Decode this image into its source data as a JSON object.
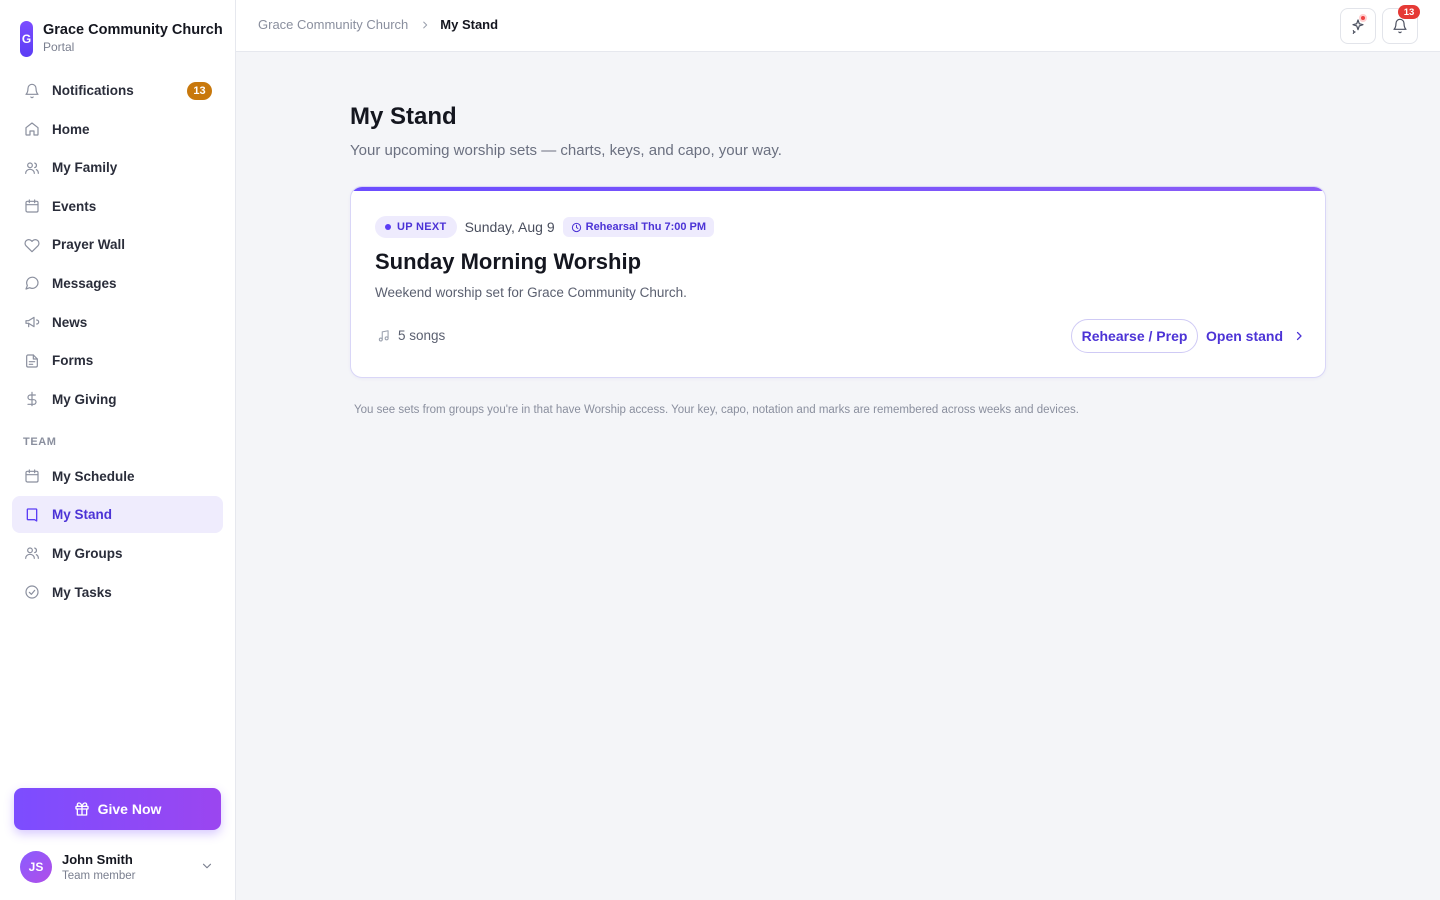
{
  "brand": {
    "initial": "G",
    "name": "Grace Community Church",
    "subtitle": "Portal"
  },
  "nav": {
    "items": [
      {
        "id": "notifications",
        "label": "Notifications",
        "icon": "bell-icon",
        "badge": "13"
      },
      {
        "id": "home",
        "label": "Home",
        "icon": "home-icon"
      },
      {
        "id": "family",
        "label": "My Family",
        "icon": "users-icon"
      },
      {
        "id": "events",
        "label": "Events",
        "icon": "calendar-icon"
      },
      {
        "id": "prayer",
        "label": "Prayer Wall",
        "icon": "heart-icon"
      },
      {
        "id": "messages",
        "label": "Messages",
        "icon": "chat-icon"
      },
      {
        "id": "news",
        "label": "News",
        "icon": "megaphone-icon"
      },
      {
        "id": "forms",
        "label": "Forms",
        "icon": "document-icon"
      },
      {
        "id": "giving",
        "label": "My Giving",
        "icon": "dollar-icon"
      }
    ],
    "team_label": "TEAM",
    "team_items": [
      {
        "id": "schedule",
        "label": "My Schedule",
        "icon": "calendar-icon"
      },
      {
        "id": "stand",
        "label": "My Stand",
        "icon": "book-icon",
        "active": true
      },
      {
        "id": "groups",
        "label": "My Groups",
        "icon": "users-icon"
      },
      {
        "id": "tasks",
        "label": "My Tasks",
        "icon": "check-circle-icon"
      }
    ]
  },
  "give_button": {
    "label": "Give Now",
    "icon": "gift-icon"
  },
  "user": {
    "initials": "JS",
    "name": "John Smith",
    "role": "Team member"
  },
  "breadcrumb": {
    "parent": "Grace Community Church",
    "current": "My Stand"
  },
  "topbar": {
    "notification_count": "13"
  },
  "page": {
    "title": "My Stand",
    "subtitle": "Your upcoming worship sets — charts, keys, and capo, your way."
  },
  "set_card": {
    "badge": "UP NEXT",
    "date": "Sunday, Aug 9",
    "rehearsal": "Rehearsal Thu 7:00 PM",
    "title": "Sunday Morning Worship",
    "description": "Weekend worship set for Grace Community Church.",
    "songs": "5 songs",
    "rehearse_label": "Rehearse / Prep",
    "open_label": "Open stand"
  },
  "footnote": "You see sets from groups you're in that have Worship access. Your key, capo, notation and marks are remembered across weeks and devices.",
  "colors": {
    "accent": "#5b3df5",
    "badge_orange": "#c8780c",
    "alert_red": "#e53935"
  }
}
